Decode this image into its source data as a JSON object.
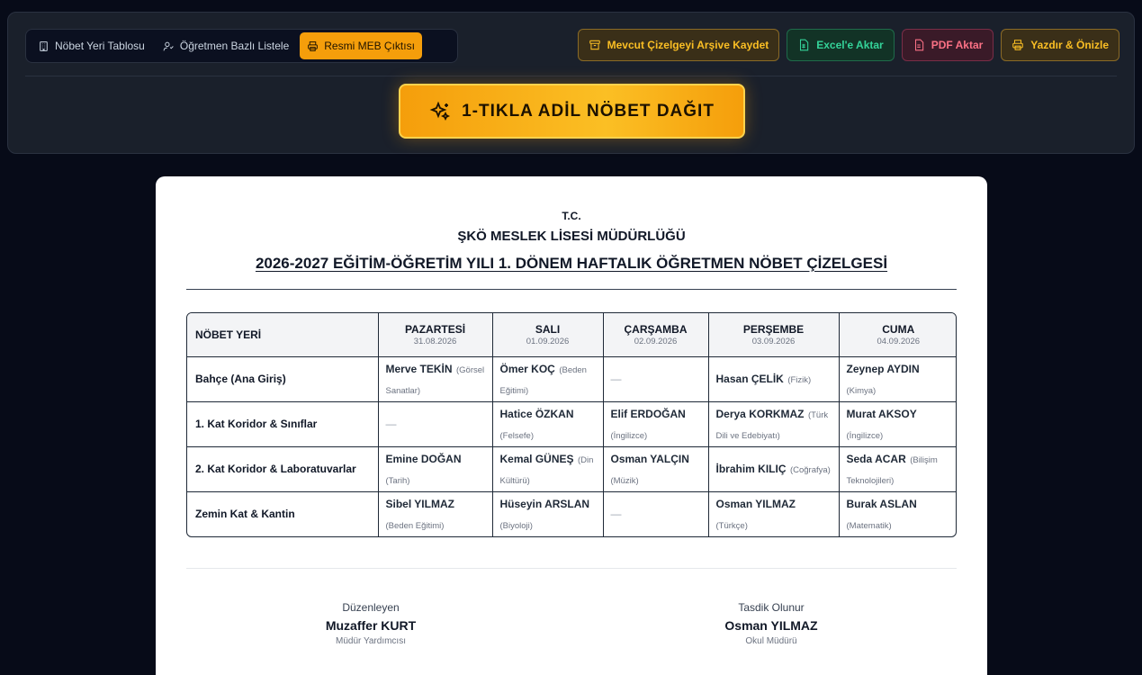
{
  "tabs": [
    {
      "label": "Nöbet Yeri Tablosu",
      "icon": "building-icon"
    },
    {
      "label": "Öğretmen Bazlı Listele",
      "icon": "user-list-icon"
    },
    {
      "label": "Resmi MEB Çıktısı",
      "icon": "printer-icon",
      "active": true
    }
  ],
  "actions": {
    "archive": "Mevcut Çizelgeyi Arşive Kaydet",
    "excel": "Excel'e Aktar",
    "pdf": "PDF Aktar",
    "print": "Yazdır & Önizle"
  },
  "distribute_button": "1-TIKLA ADİL NÖBET DAĞIT",
  "document": {
    "tc": "T.C.",
    "school": "ŞKÖ MESLEK LİSESİ MÜDÜRLÜĞÜ",
    "title": "2026-2027 EĞİTİM-ÖĞRETİM YILI 1. DÖNEM HAFTALIK ÖĞRETMEN NÖBET ÇİZELGESİ"
  },
  "table": {
    "location_header": "NÖBET YERİ",
    "days": [
      {
        "name": "PAZARTESİ",
        "date": "31.08.2026"
      },
      {
        "name": "SALI",
        "date": "01.09.2026"
      },
      {
        "name": "ÇARŞAMBA",
        "date": "02.09.2026"
      },
      {
        "name": "PERŞEMBE",
        "date": "03.09.2026"
      },
      {
        "name": "CUMA",
        "date": "04.09.2026"
      }
    ],
    "rows": [
      {
        "location": "Bahçe (Ana Giriş)",
        "cells": [
          {
            "name": "Merve TEKİN",
            "branch": "(Görsel Sanatlar)"
          },
          {
            "name": "Ömer KOÇ",
            "branch": "(Beden Eğitimi)"
          },
          {
            "empty": "—"
          },
          {
            "name": "Hasan ÇELİK",
            "branch": "(Fizik)"
          },
          {
            "name": "Zeynep AYDIN",
            "branch": "(Kimya)"
          }
        ]
      },
      {
        "location": "1. Kat Koridor & Sınıflar",
        "cells": [
          {
            "empty": "—"
          },
          {
            "name": "Hatice ÖZKAN",
            "branch": "(Felsefe)"
          },
          {
            "name": "Elif ERDOĞAN",
            "branch": "(İngilizce)"
          },
          {
            "name": "Derya KORKMAZ",
            "branch": "(Türk Dili ve Edebiyatı)"
          },
          {
            "name": "Murat AKSOY",
            "branch": "(İngilizce)"
          }
        ]
      },
      {
        "location": "2. Kat Koridor & Laboratuvarlar",
        "cells": [
          {
            "name": "Emine DOĞAN",
            "branch": "(Tarih)"
          },
          {
            "name": "Kemal GÜNEŞ",
            "branch": "(Din Kültürü)"
          },
          {
            "name": "Osman YALÇIN",
            "branch": "(Müzik)"
          },
          {
            "name": "İbrahim KILIÇ",
            "branch": "(Coğrafya)"
          },
          {
            "name": "Seda ACAR",
            "branch": "(Bilişim Teknolojileri)"
          }
        ]
      },
      {
        "location": "Zemin Kat & Kantin",
        "cells": [
          {
            "name": "Sibel YILMAZ",
            "branch": "(Beden Eğitimi)"
          },
          {
            "name": "Hüseyin ARSLAN",
            "branch": "(Biyoloji)"
          },
          {
            "empty": "—"
          },
          {
            "name": "Osman YILMAZ",
            "branch": "(Türkçe)"
          },
          {
            "name": "Burak ASLAN",
            "branch": "(Matematik)"
          }
        ]
      }
    ]
  },
  "signatures": {
    "left": {
      "label": "Düzenleyen",
      "name": "Muzaffer KURT",
      "role": "Müdür Yardımcısı"
    },
    "right": {
      "label": "Tasdik Olunur",
      "name": "Osman YILMAZ",
      "role": "Okul Müdürü"
    }
  },
  "colors": {
    "background": "#070b18",
    "accent": "#f59e0b",
    "excel": "#34d399",
    "pdf": "#fb7185"
  }
}
